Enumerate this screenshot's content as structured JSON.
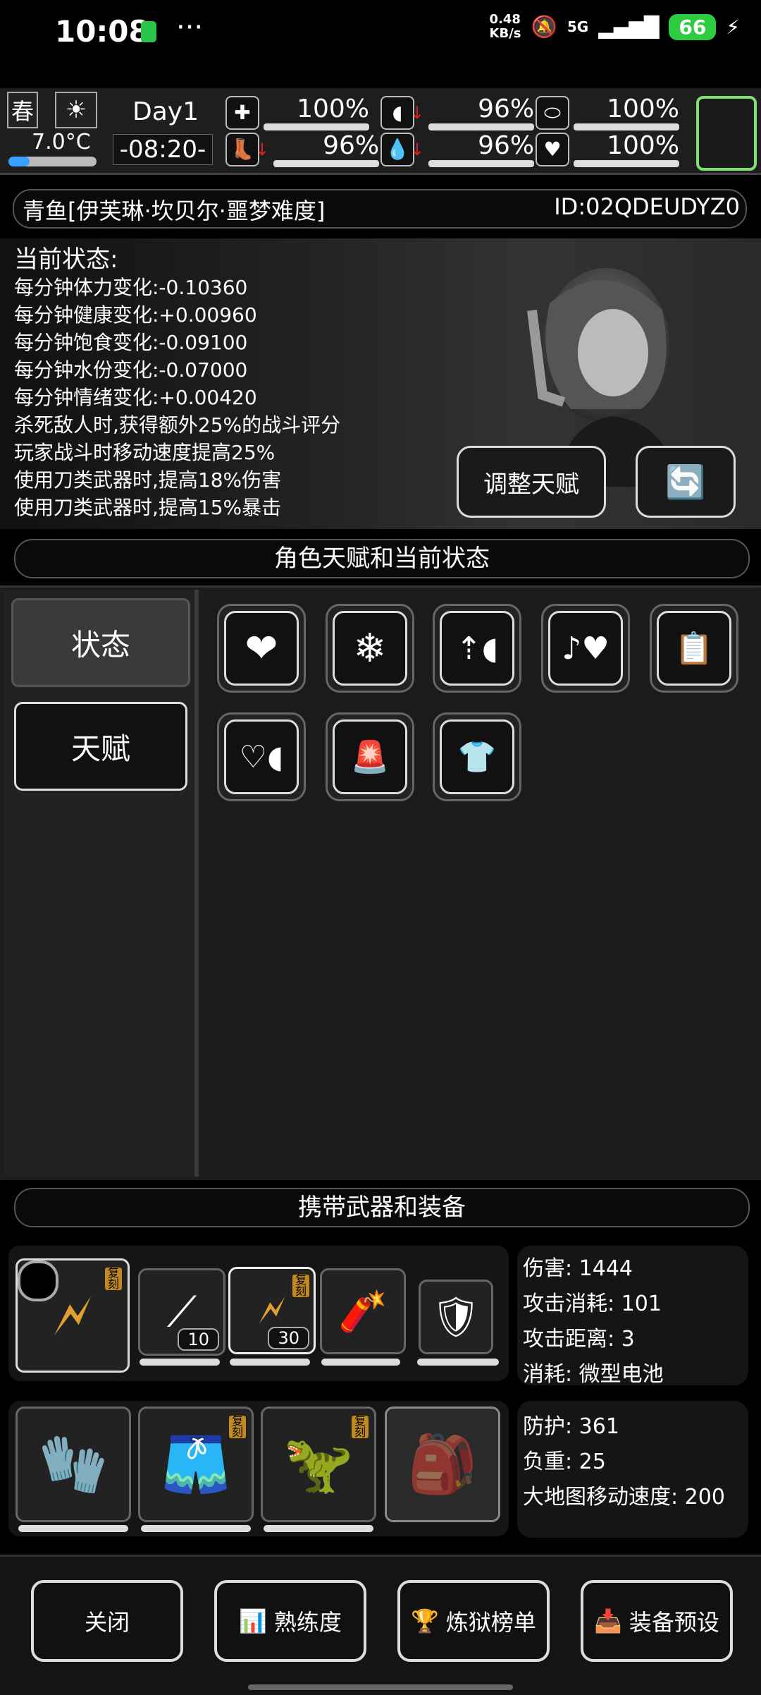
{
  "status_bar": {
    "time": "10:08",
    "net_speed": "0.48\nKB/s",
    "signal": "5G",
    "battery": "66"
  },
  "top": {
    "season": "春",
    "temperature": "7.0°C",
    "day": "Day1",
    "clock": "-08:20-",
    "stats": [
      {
        "icon": "medkit-icon",
        "value": "100%",
        "down": false
      },
      {
        "icon": "stomach-icon",
        "value": "96%",
        "down": true
      },
      {
        "icon": "pill-icon",
        "value": "100%",
        "down": false
      },
      {
        "icon": "boot-icon",
        "value": "96%",
        "down": true
      },
      {
        "icon": "water-drop-icon",
        "value": "96%",
        "down": true
      },
      {
        "icon": "heart-icon",
        "value": "100%",
        "down": false
      }
    ]
  },
  "character": {
    "name": "青鱼[伊芙琳·坎贝尔·噩梦难度]",
    "id": "ID:02QDEUDYZ0"
  },
  "status": {
    "title": "当前状态:",
    "lines": [
      "每分钟体力变化:-0.10360",
      "每分钟健康变化:+0.00960",
      "每分钟饱食变化:-0.09100",
      "每分钟水份变化:-0.07000",
      "每分钟情绪变化:+0.00420",
      "杀死敌人时,获得额外25%的战斗评分",
      "玩家战斗时移动速度提高25%",
      "使用刀类武器时,提高18%伤害",
      "使用刀类武器时,提高15%暴击"
    ],
    "adjust_button": "调整天赋"
  },
  "talents_section": {
    "title": "角色天赋和当前状态",
    "tabs": [
      "状态",
      "天赋"
    ],
    "icons": [
      "heart-icon",
      "snowflake-icon",
      "stomach-up-icon",
      "music-heart-icon",
      "medicine-clipboard-icon",
      "stomach-heart-icon",
      "alarm-person-icon",
      "tshirt-icon"
    ]
  },
  "equipment_section": {
    "title": "携带武器和装备",
    "weapon_counts": [
      "10",
      "30"
    ],
    "replica_tag": "复刻",
    "weapon_info": [
      "伤害: 1444",
      "攻击消耗: 101",
      "攻击距离: 3",
      "消耗: 微型电池"
    ],
    "armor_info": [
      "防护: 361",
      "负重: 25",
      "大地图移动速度: 200"
    ]
  },
  "bottom_buttons": [
    "关闭",
    "熟练度",
    "炼狱榜单",
    "装备预设"
  ]
}
